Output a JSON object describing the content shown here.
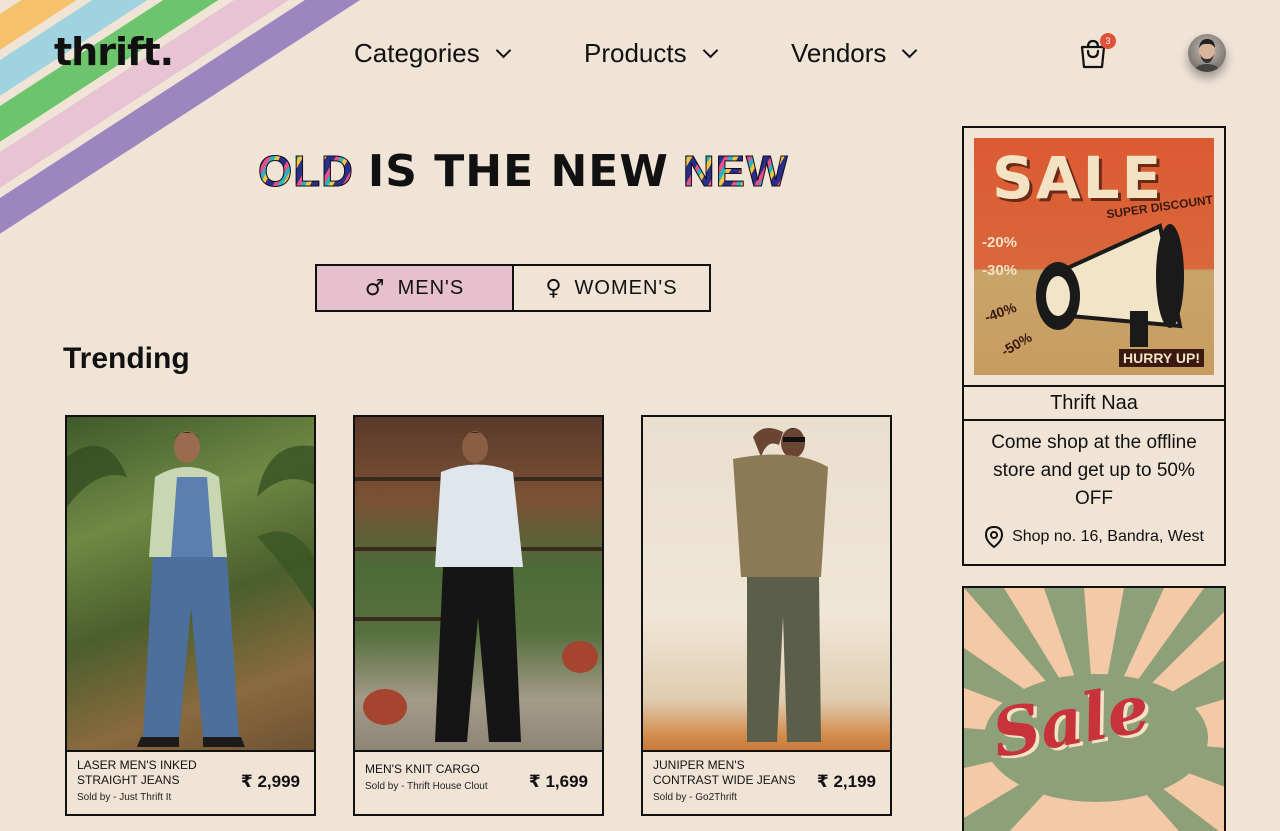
{
  "brand": {
    "logo": "thrift."
  },
  "nav": {
    "categories": "Categories",
    "products": "Products",
    "vendors": "Vendors"
  },
  "cart": {
    "count": "3",
    "icon": "cart-icon"
  },
  "headline": {
    "old": "OLD",
    "middle": "IS THE NEW",
    "new": "NEW"
  },
  "gender": {
    "mens": "MEN'S",
    "womens": "WOMEN'S",
    "mens_symbol": "♂",
    "womens_symbol": "♀",
    "selected": "MEN'S"
  },
  "section": {
    "trending": "Trending"
  },
  "products": [
    {
      "name": "LASER MEN'S INKED STRAIGHT JEANS",
      "seller": "Sold by - Just Thrift It",
      "price": "₹ 2,999"
    },
    {
      "name": "MEN'S KNIT CARGO",
      "seller": "Sold by - Thrift House Clout",
      "price": "₹ 1,699"
    },
    {
      "name": "JUNIPER MEN'S CONTRAST WIDE JEANS",
      "seller": "Sold by - Go2Thrift",
      "price": "₹ 2,199"
    }
  ],
  "promo": {
    "sale_big": "SALE",
    "super_discount": "SUPER DISCOUNT",
    "discounts": [
      "-20%",
      "-30%",
      "-40%",
      "-50%"
    ],
    "hurry": "HURRY UP!",
    "store_name": "Thrift Naa",
    "text": "Come shop at the offline store and get up to 50% OFF",
    "location": "Shop no. 16, Bandra, West"
  },
  "promo2": {
    "sale": "Sale"
  },
  "colors": {
    "background": "#f0e4d7",
    "active_tab": "#e6c0cd",
    "badge": "#e0503a",
    "stripes": [
      "#f5c26b",
      "#9fd3df",
      "#6cc46c",
      "#e7c3d3",
      "#9b86c0"
    ]
  }
}
